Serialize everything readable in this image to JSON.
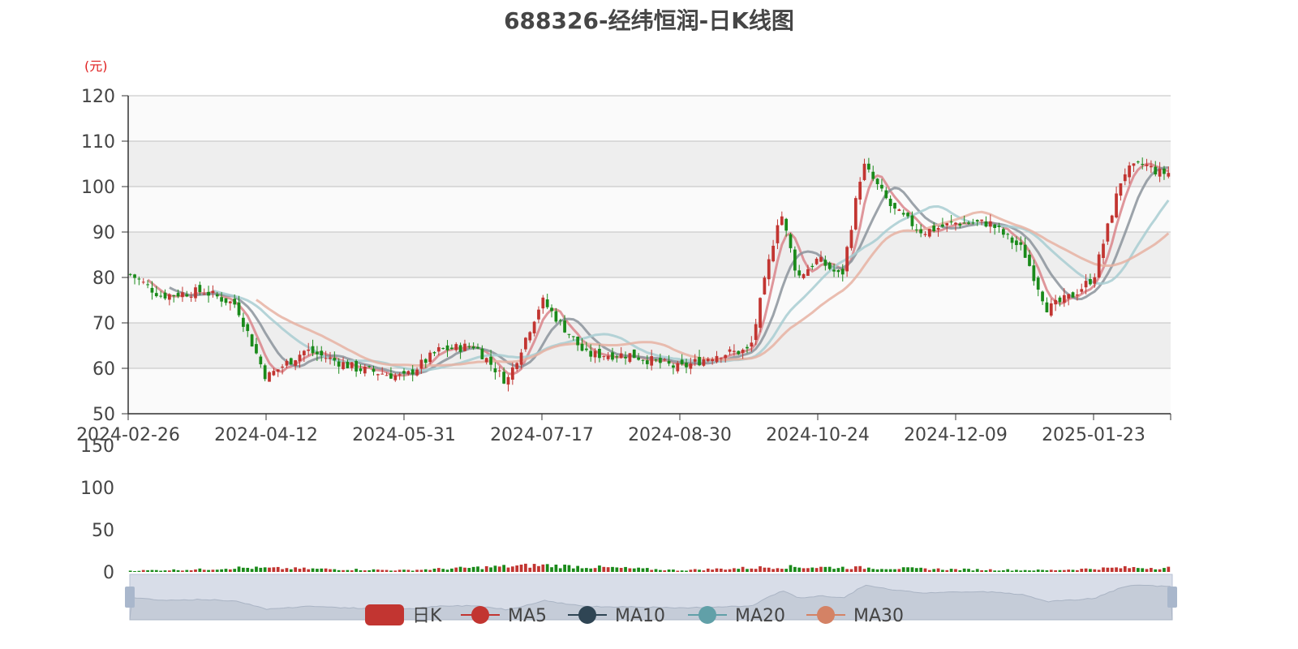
{
  "chart_data": {
    "type": "candlestick",
    "title": "688326-经纬恒润-日K线图",
    "unit_label": "(元)",
    "price_axis": {
      "ylim": [
        50,
        120
      ],
      "ticks": [
        "50",
        "60",
        "70",
        "80",
        "90",
        "100",
        "110",
        "120"
      ]
    },
    "volume_axis": {
      "ylim": [
        0,
        150
      ],
      "ticks": [
        "0",
        "50",
        "100",
        "150"
      ]
    },
    "x_tick_labels": [
      "2024-02-26",
      "2024-04-12",
      "2024-05-31",
      "2024-07-17",
      "2024-08-30",
      "2024-10-24",
      "2024-12-09",
      "2025-01-23"
    ],
    "grid": true,
    "legend_position": "bottom",
    "colors": {
      "up": "#c23531",
      "down": "#1a8a1a",
      "ma5": "#d9848a",
      "ma10": "#8b939b",
      "ma20": "#a8cdd1",
      "ma30": "#e6b2a2"
    },
    "legend": [
      {
        "name": "日K",
        "color": "#c23531"
      },
      {
        "name": "MA5",
        "color": "#c23531"
      },
      {
        "name": "MA10",
        "color": "#2f4554"
      },
      {
        "name": "MA20",
        "color": "#61a0a8"
      },
      {
        "name": "MA30",
        "color": "#d48265"
      }
    ],
    "close_approx": [
      {
        "date": "2024-02-26",
        "close": 81
      },
      {
        "date": "2024-03-08",
        "close": 76
      },
      {
        "date": "2024-03-22",
        "close": 77
      },
      {
        "date": "2024-04-02",
        "close": 74
      },
      {
        "date": "2024-04-12",
        "close": 58
      },
      {
        "date": "2024-04-26",
        "close": 64
      },
      {
        "date": "2024-05-14",
        "close": 60
      },
      {
        "date": "2024-05-31",
        "close": 58
      },
      {
        "date": "2024-06-12",
        "close": 64
      },
      {
        "date": "2024-06-24",
        "close": 65
      },
      {
        "date": "2024-07-05",
        "close": 57
      },
      {
        "date": "2024-07-17",
        "close": 75
      },
      {
        "date": "2024-07-31",
        "close": 63
      },
      {
        "date": "2024-08-14",
        "close": 63
      },
      {
        "date": "2024-08-30",
        "close": 60
      },
      {
        "date": "2024-09-13",
        "close": 63
      },
      {
        "date": "2024-09-27",
        "close": 64
      },
      {
        "date": "2024-10-09",
        "close": 95
      },
      {
        "date": "2024-10-16",
        "close": 80
      },
      {
        "date": "2024-10-24",
        "close": 84
      },
      {
        "date": "2024-11-01",
        "close": 80
      },
      {
        "date": "2024-11-08",
        "close": 105
      },
      {
        "date": "2024-11-18",
        "close": 95
      },
      {
        "date": "2024-11-28",
        "close": 90
      },
      {
        "date": "2024-12-09",
        "close": 92
      },
      {
        "date": "2024-12-20",
        "close": 92
      },
      {
        "date": "2024-12-31",
        "close": 86
      },
      {
        "date": "2025-01-08",
        "close": 73
      },
      {
        "date": "2025-01-16",
        "close": 76
      },
      {
        "date": "2025-01-23",
        "close": 80
      },
      {
        "date": "2025-02-05",
        "close": 103
      },
      {
        "date": "2025-02-14",
        "close": 105
      },
      {
        "date": "2025-02-21",
        "close": 103
      }
    ],
    "volume_approx": [
      {
        "date": "2024-02-26",
        "volume": 1.5
      },
      {
        "date": "2024-03-22",
        "volume": 3
      },
      {
        "date": "2024-04-02",
        "volume": 5
      },
      {
        "date": "2024-05-31",
        "volume": 2
      },
      {
        "date": "2024-07-17",
        "volume": 8
      },
      {
        "date": "2024-08-30",
        "volume": 2
      },
      {
        "date": "2024-10-09",
        "volume": 6
      },
      {
        "date": "2024-11-08",
        "volume": 5
      },
      {
        "date": "2024-12-09",
        "volume": 3
      },
      {
        "date": "2025-01-08",
        "volume": 2
      },
      {
        "date": "2025-02-05",
        "volume": 5
      }
    ]
  }
}
